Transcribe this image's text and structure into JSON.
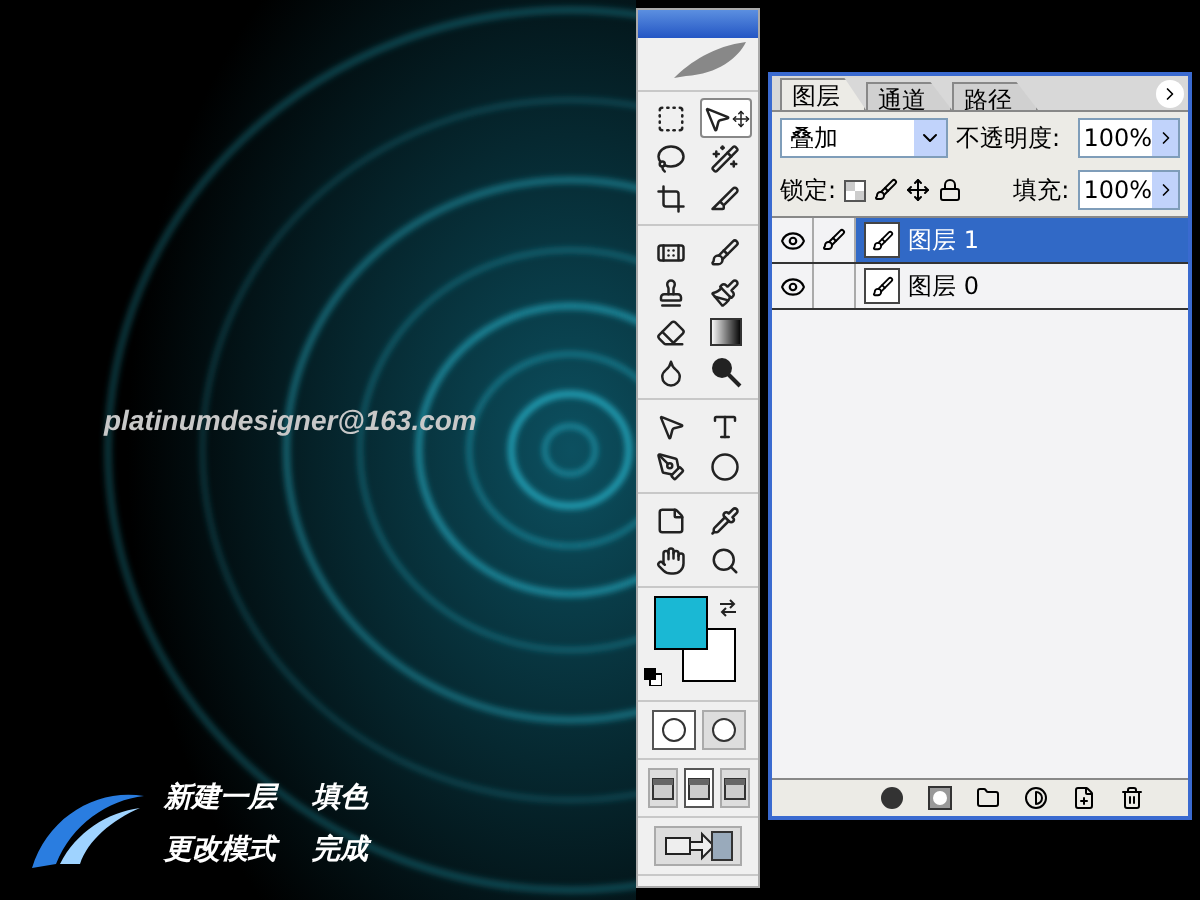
{
  "artwork": {
    "credit": "platinumdesigner@163.com"
  },
  "steps": [
    {
      "first": "新建一层",
      "second": "填色"
    },
    {
      "first": "更改模式",
      "second": "完成"
    }
  ],
  "toolbox": {
    "tool_groups": [
      {
        "tools": [
          {
            "kind": "marquee",
            "selected": false
          },
          {
            "kind": "move",
            "selected": true
          },
          {
            "kind": "lasso",
            "selected": false
          },
          {
            "kind": "wand",
            "selected": false
          },
          {
            "kind": "crop",
            "selected": false
          },
          {
            "kind": "slice",
            "selected": false
          }
        ]
      },
      {
        "tools": [
          {
            "kind": "healing",
            "selected": false
          },
          {
            "kind": "brush",
            "selected": false
          },
          {
            "kind": "stamp",
            "selected": false
          },
          {
            "kind": "history",
            "selected": false
          },
          {
            "kind": "eraser",
            "selected": false
          },
          {
            "kind": "gradient",
            "selected": false
          },
          {
            "kind": "blur",
            "selected": false
          },
          {
            "kind": "dodge",
            "selected": false
          }
        ]
      },
      {
        "tools": [
          {
            "kind": "pointer",
            "selected": false
          },
          {
            "kind": "type",
            "selected": false
          },
          {
            "kind": "pen",
            "selected": false
          },
          {
            "kind": "shape",
            "selected": false
          }
        ]
      },
      {
        "tools": [
          {
            "kind": "notes",
            "selected": false
          },
          {
            "kind": "eyedropper",
            "selected": false
          },
          {
            "kind": "hand",
            "selected": false
          },
          {
            "kind": "zoom",
            "selected": false
          }
        ]
      }
    ],
    "color_swatches": [
      {
        "kind": "background",
        "color": "#ffffff"
      },
      {
        "kind": "foreground",
        "color": "#1ab8d4"
      }
    ],
    "mask_modes": [
      {
        "selected": true
      },
      {
        "selected": false
      }
    ],
    "screen_modes": [
      {
        "selected": false
      },
      {
        "selected": true
      },
      {
        "selected": false
      }
    ]
  },
  "layers_panel": {
    "tabs": [
      {
        "label": "图层",
        "selected": true
      },
      {
        "label": "通道",
        "selected": false
      },
      {
        "label": "路径",
        "selected": false
      }
    ],
    "blend_mode": "叠加",
    "opacity_label": "不透明度:",
    "opacity": "100%",
    "lock_label": "锁定:",
    "fill_label": "填充:",
    "fill": "100%",
    "layers": [
      {
        "name": "图层 1",
        "selected": true,
        "visible": true
      },
      {
        "name": "图层 0",
        "selected": false,
        "visible": true
      }
    ]
  }
}
